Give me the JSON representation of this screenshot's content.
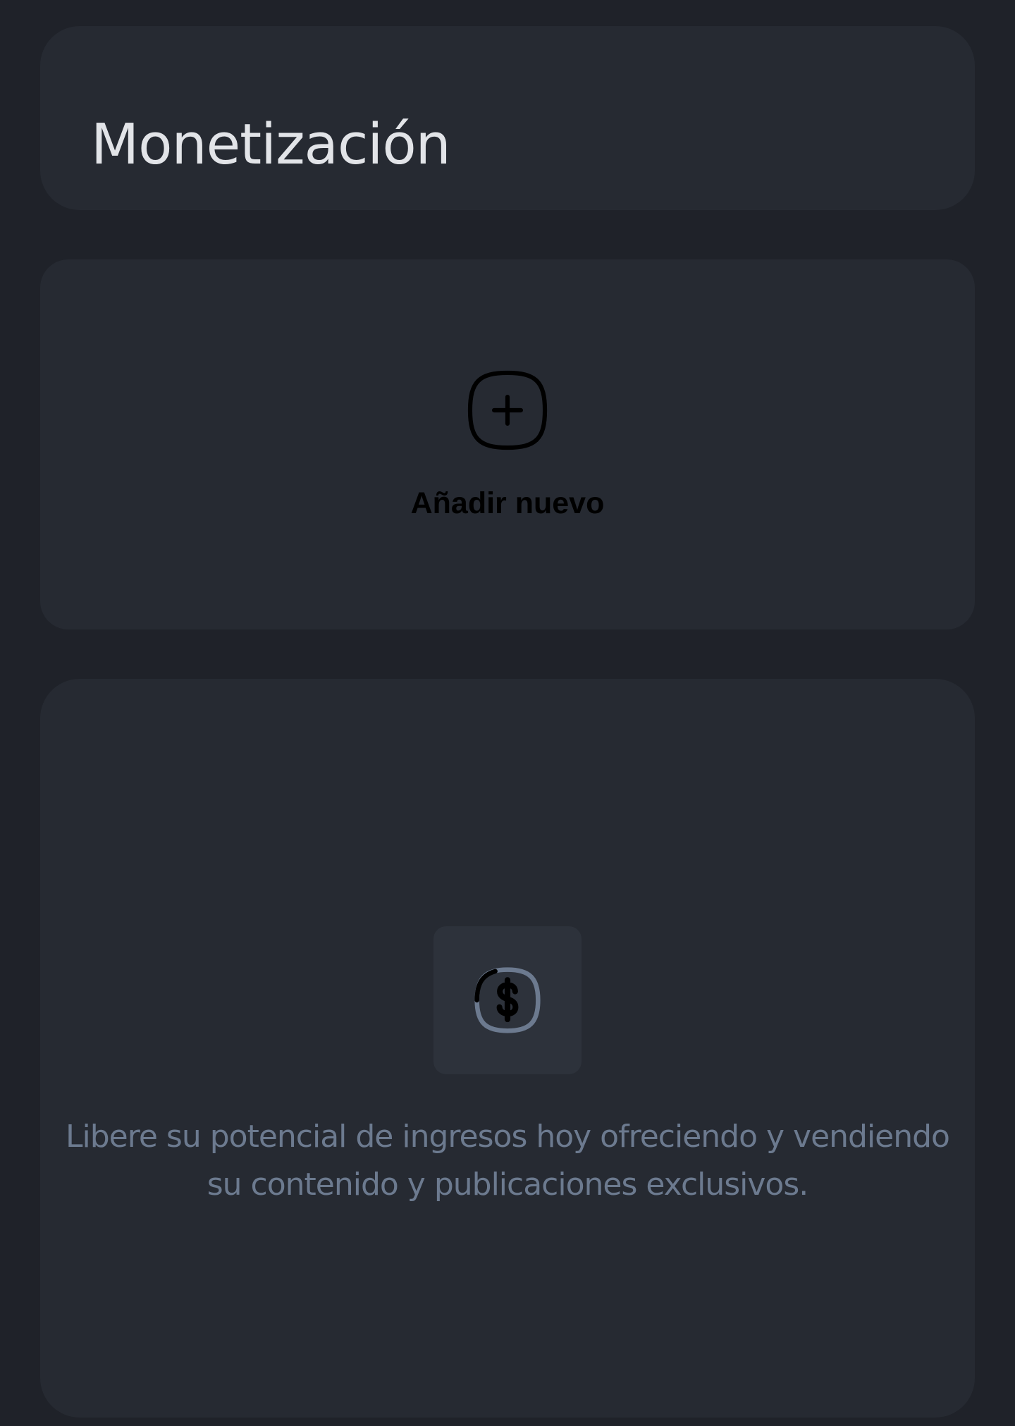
{
  "header": {
    "title": "Monetización"
  },
  "add_card": {
    "icon": "plus-squircle-icon",
    "label": "Añadir nuevo"
  },
  "empty_state": {
    "icon": "dollar-squircle-icon",
    "message": "Libere su potencial de ingresos hoy ofreciendo y vendiendo su contenido y publicaciones exclusivos."
  },
  "colors": {
    "page_background": "#1f2229",
    "card_background": "#262a32",
    "icon_tile_background": "#2d323b",
    "title_text": "#e2e4e8",
    "muted_text": "#6c7a8f",
    "add_label_text": "#000000"
  }
}
